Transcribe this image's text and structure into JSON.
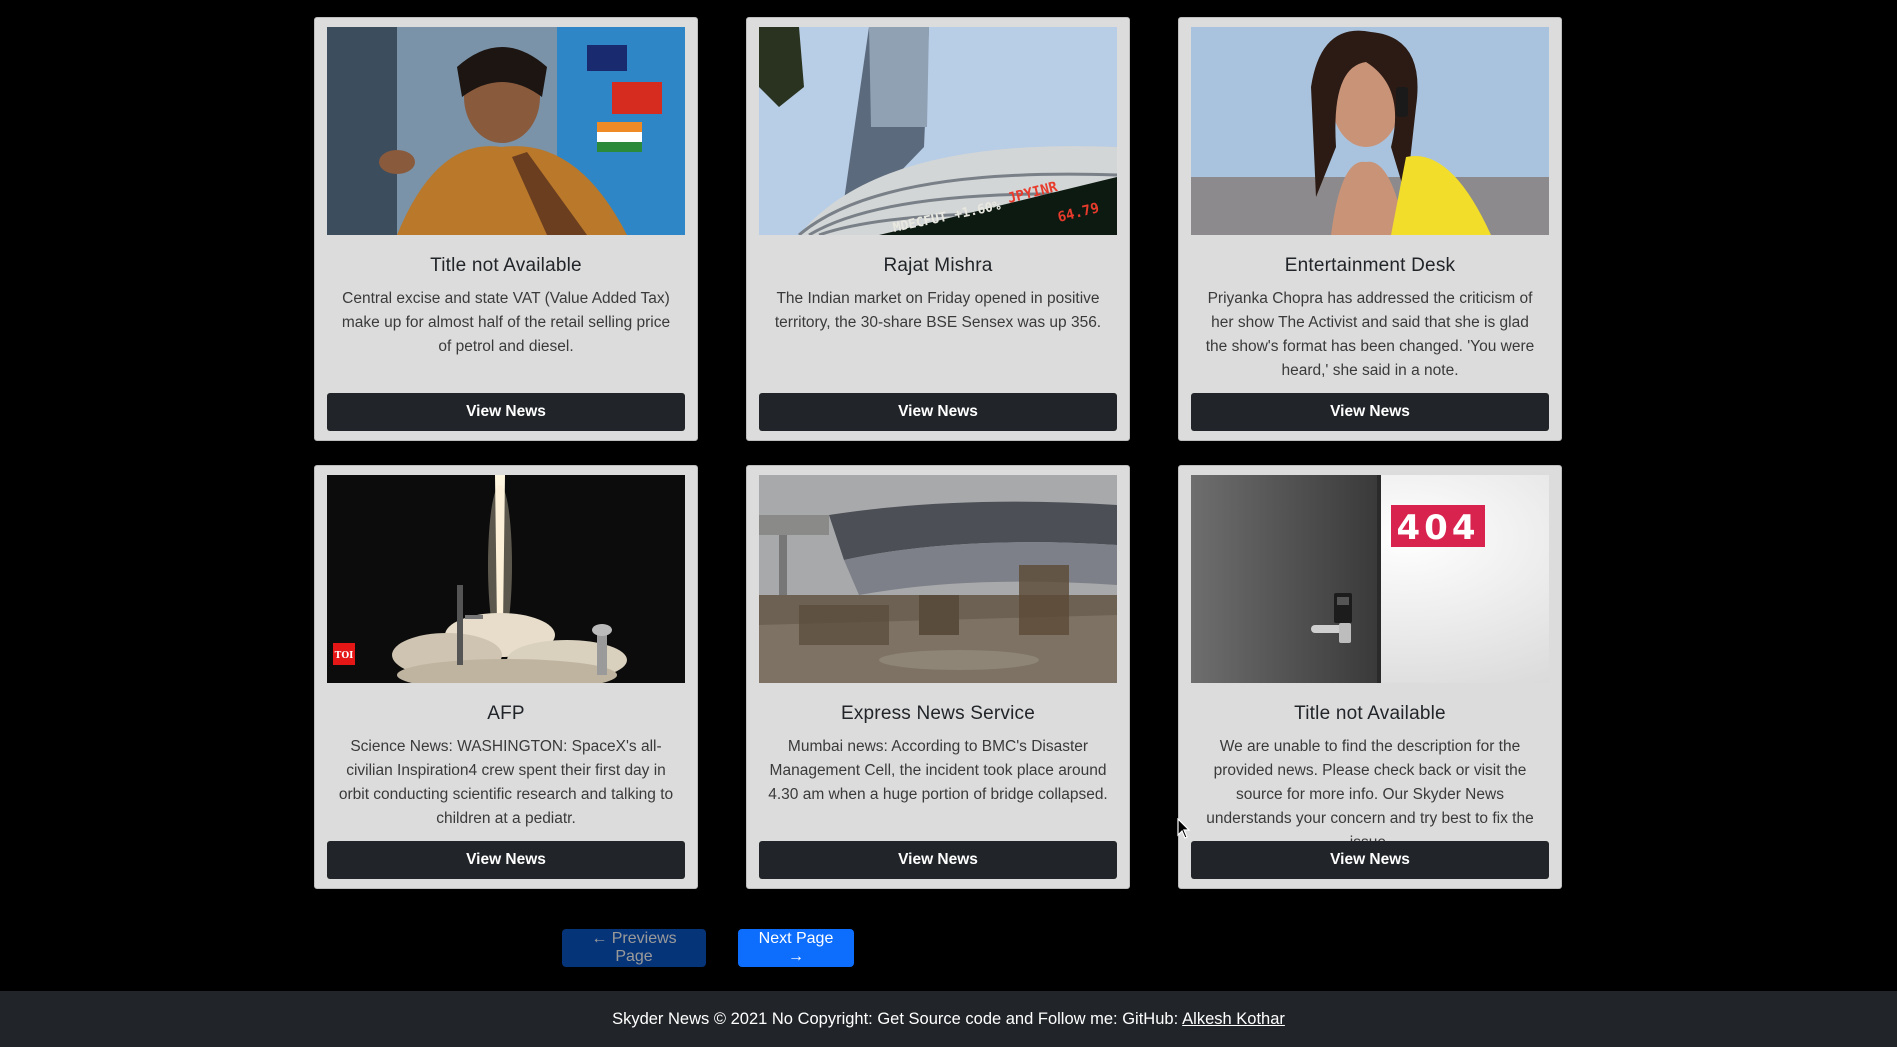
{
  "cards": [
    {
      "image": "finance-minister-photo",
      "title": "Title not Available",
      "description": "Central excise and state VAT (Value Added Tax) make up for almost half of the retail selling price of petrol and diesel.",
      "button": "View News"
    },
    {
      "image": "stock-exchange-building-photo",
      "title": "Rajat Mishra",
      "description": "The Indian market on Friday opened in positive territory, the 30-share BSE Sensex was up 356.",
      "button": "View News",
      "image_text": [
        "JPYINR",
        "64.79",
        "MDECFUT +1.60%"
      ]
    },
    {
      "image": "actress-portrait-photo",
      "title": "Entertainment Desk",
      "description": "Priyanka Chopra has addressed the criticism of her show The Activist and said that she is glad the show's format has been changed. 'You were heard,' she said in a note.",
      "button": "View News"
    },
    {
      "image": "rocket-launch-photo",
      "title": "AFP",
      "description": "Science News: WASHINGTON: SpaceX's all-civilian Inspiration4 crew spent their first day in orbit conducting scientific research and talking to children at a pediatr.",
      "button": "View News",
      "image_text": [
        "TOI"
      ]
    },
    {
      "image": "collapsed-bridge-photo",
      "title": "Express News Service",
      "description": "Mumbai news: According to BMC's Disaster Management Cell, the incident took place around 4.30 am when a huge portion of bridge collapsed.",
      "button": "View News"
    },
    {
      "image": "404-door-image",
      "title": "Title not Available",
      "description": "We are unable to find the description for the provided news. Please check back or visit the source for more info. Our Skyder News understands your concern and try best to fix the issue.",
      "button": "View News",
      "image_text": [
        "404"
      ]
    }
  ],
  "pagination": {
    "prev_label": "← Previews Page",
    "next_label": "Next Page →"
  },
  "footer": {
    "text": "Skyder News © 2021 No Copyright: Get Source code and Follow me: GitHub:",
    "link_text": "Alkesh Kothar"
  },
  "colors": {
    "card_bg": "#dcdcdc",
    "button_dark": "#212529",
    "primary": "#0d6efd",
    "page_bg": "#000000"
  }
}
